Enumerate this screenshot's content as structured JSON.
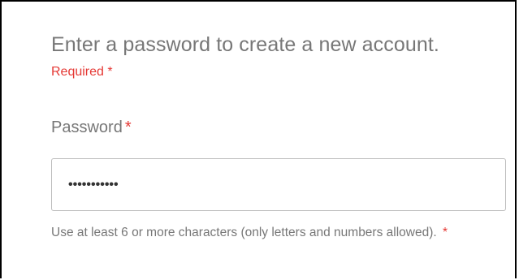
{
  "form": {
    "heading": "Enter a password to create a new account.",
    "required_note": "Required *",
    "password_label": "Password",
    "required_star": "*",
    "password_value": "•••••••••••",
    "hint_text": "Use at least 6 or more characters (only letters and numbers allowed).",
    "hint_star": "*"
  },
  "colors": {
    "required": "#e53935",
    "text_muted": "#777777",
    "border": "#bdbdbd"
  }
}
